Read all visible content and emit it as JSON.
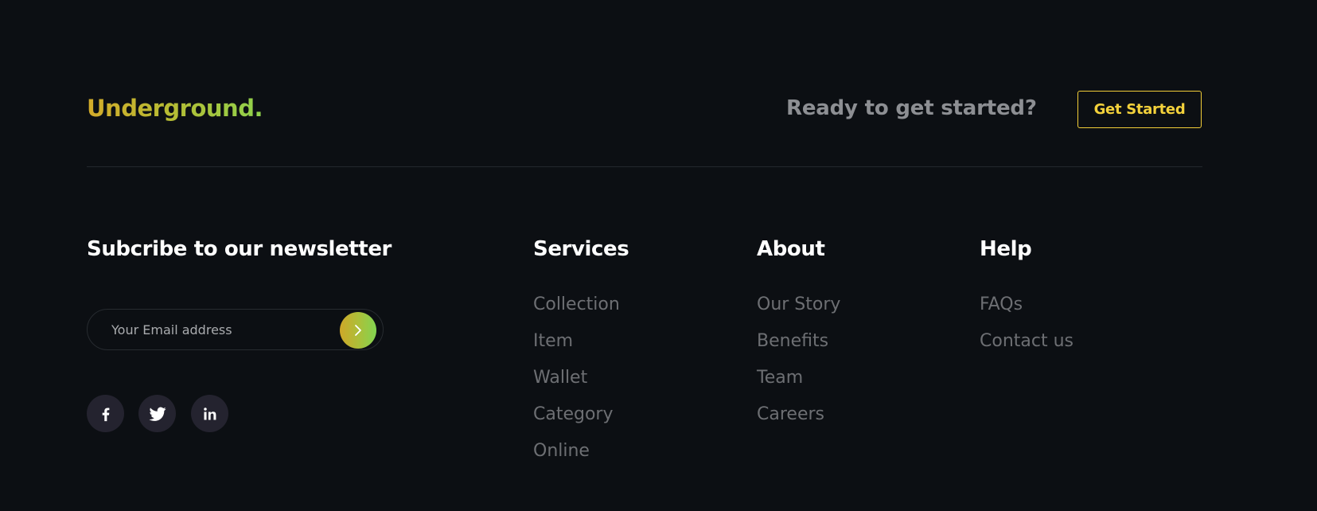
{
  "brand": {
    "logo_text": "Underground."
  },
  "cta": {
    "text": "Ready to get started?",
    "button_label": "Get Started"
  },
  "newsletter": {
    "heading": "Subcribe to our newsletter",
    "input_placeholder": "Your Email address",
    "input_value": "",
    "submit_icon": "chevron-right-icon"
  },
  "social": [
    {
      "name": "facebook-icon"
    },
    {
      "name": "twitter-icon"
    },
    {
      "name": "linkedin-icon"
    }
  ],
  "columns": {
    "services": {
      "heading": "Services",
      "links": [
        "Collection",
        "Item",
        "Wallet",
        "Category",
        "Online"
      ]
    },
    "about": {
      "heading": "About",
      "links": [
        "Our Story",
        "Benefits",
        "Team",
        "Careers"
      ]
    },
    "help": {
      "heading": "Help",
      "links": [
        "FAQs",
        "Contact us"
      ]
    }
  },
  "colors": {
    "background": "#0c0f13",
    "accent_yellow": "#f3d13b",
    "gradient_start": "#d4ab2a",
    "gradient_end": "#8fd24c",
    "muted_text": "#6d6f73",
    "social_bg": "#24232f"
  }
}
